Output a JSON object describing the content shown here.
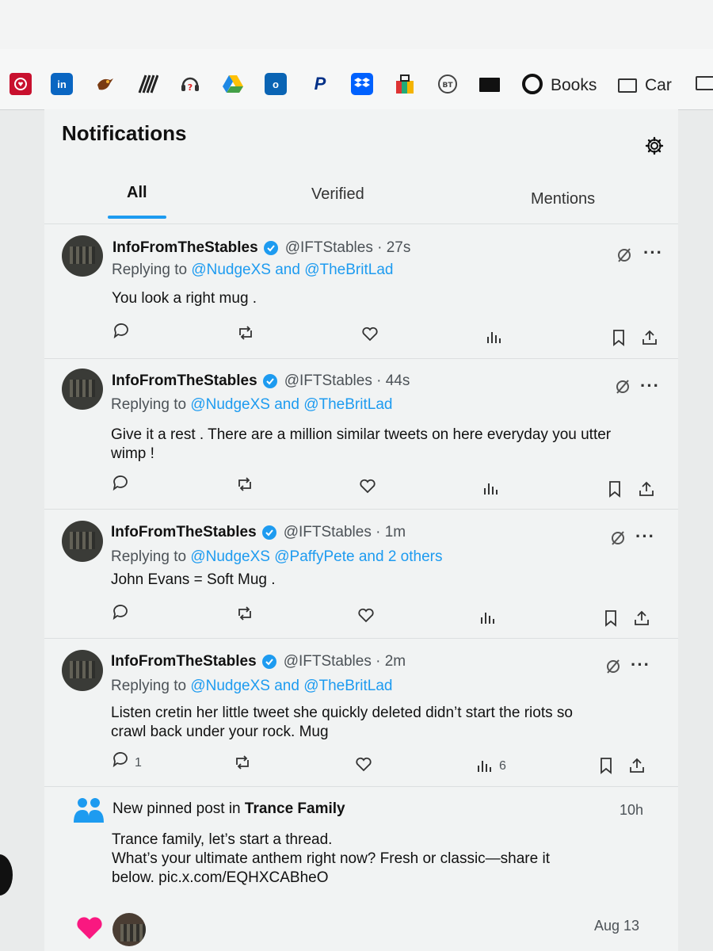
{
  "bookmarks": {
    "books_label": "Books",
    "car_label": "Car"
  },
  "header": {
    "title": "Notifications"
  },
  "tabs": [
    {
      "label": "All"
    },
    {
      "label": "Verified"
    },
    {
      "label": "Mentions"
    }
  ],
  "tweets": [
    {
      "name": "InfoFromTheStables",
      "handle": "@IFTStables",
      "time": "· 27s",
      "replying_prefix": "Replying to",
      "replying_to": "@NudgeXS and @TheBritLad",
      "text_lines": [
        "You look a right mug ."
      ],
      "reply_count": "",
      "views": ""
    },
    {
      "name": "InfoFromTheStables",
      "handle": "@IFTStables",
      "time": "· 44s",
      "replying_prefix": "Replying to",
      "replying_to": "@NudgeXS and @TheBritLad",
      "text_lines": [
        "Give it a rest . There are a million similar tweets on here everyday you utter",
        "wimp !"
      ],
      "reply_count": "",
      "views": ""
    },
    {
      "name": "InfoFromTheStables",
      "handle": "@IFTStables",
      "time": "· 1m",
      "replying_prefix": "Replying to",
      "replying_to": "@NudgeXS @PaffyPete and 2 others",
      "text_lines": [
        "John Evans = Soft Mug ."
      ],
      "reply_count": "",
      "views": ""
    },
    {
      "name": "InfoFromTheStables",
      "handle": "@IFTStables",
      "time": "· 2m",
      "replying_prefix": "Replying to",
      "replying_to": "@NudgeXS and @TheBritLad",
      "text_lines": [
        "Listen cretin her little tweet she quickly deleted didn’t start the riots so",
        "crawl back under your rock. Mug"
      ],
      "reply_count": "1",
      "views": "6"
    }
  ],
  "pinned": {
    "prefix": "New pinned post in",
    "community": "Trance Family",
    "time": "10h",
    "text_lines": [
      "Trance family, let’s start a thread.",
      "What’s your ultimate anthem right now? Fresh or classic—share it",
      "below. pic.x.com/EQHXCABheO"
    ]
  },
  "like_notice": {
    "time": "Aug 13"
  },
  "colors": {
    "accent": "#1d9bf0",
    "like": "#f91880",
    "text": "#0f1419"
  }
}
